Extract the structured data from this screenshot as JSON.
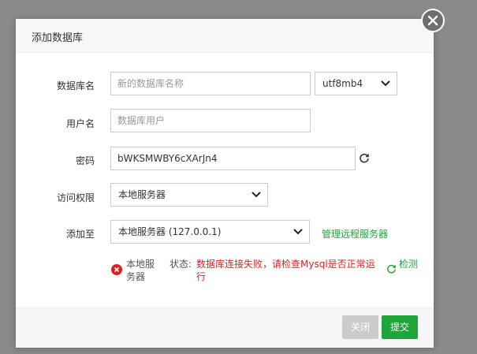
{
  "dialog": {
    "title": "添加数据库"
  },
  "form": {
    "db_name": {
      "label": "数据库名",
      "placeholder": "新的数据库名称",
      "charset": "utf8mb4"
    },
    "username": {
      "label": "用户名",
      "placeholder": "数据库用户"
    },
    "password": {
      "label": "密码",
      "value": "bWKSMWBY6cXArJn4"
    },
    "access": {
      "label": "访问权限",
      "value": "本地服务器"
    },
    "add_to": {
      "label": "添加至",
      "value": "本地服务器 (127.0.0.1)",
      "manage_link": "管理远程服务器"
    },
    "status": {
      "server": "本地服务器",
      "state_label": "状态:",
      "message": "数据库连接失败，请检查Mysql是否正常运行",
      "check": "检测"
    }
  },
  "footer": {
    "close_label": "关闭",
    "submit_label": "提交"
  },
  "colors": {
    "accent": "#20a53a",
    "error": "#e02020"
  }
}
